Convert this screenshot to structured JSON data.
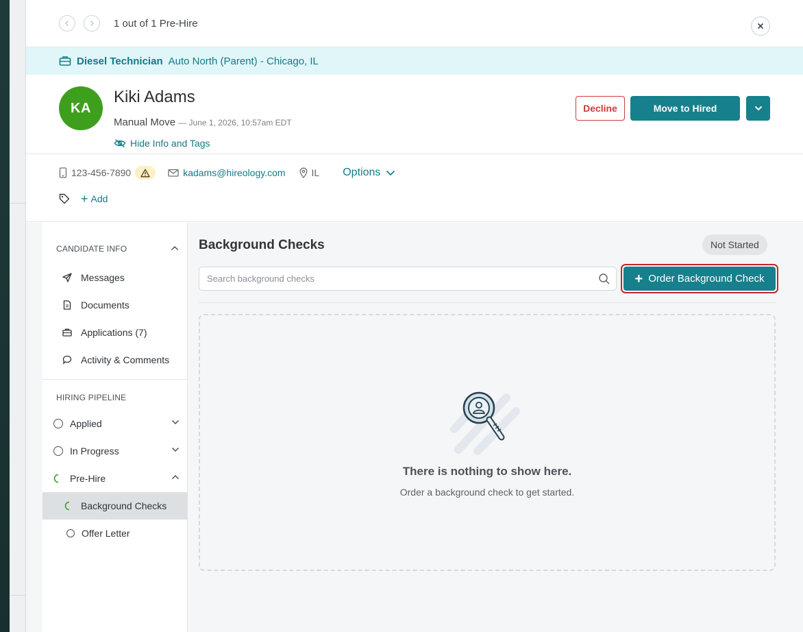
{
  "pager": {
    "text": "1 out of 1 Pre-Hire"
  },
  "job": {
    "title": "Diesel Technician",
    "location": "Auto North (Parent) - Chicago, IL"
  },
  "candidate": {
    "initials": "KA",
    "name": "Kiki Adams",
    "move_type": "Manual Move",
    "move_date": "— June 1, 2026, 10:57am EDT",
    "hide_info_label": "Hide Info and Tags",
    "avatar_color": "#3e9f1d"
  },
  "actions": {
    "decline_label": "Decline",
    "hire_label": "Move to Hired"
  },
  "contact": {
    "phone": "123-456-7890",
    "email": "kadams@hireology.com",
    "state": "IL",
    "options_label": "Options"
  },
  "tags": {
    "add_label": "Add"
  },
  "sidebar": {
    "candidate_info_header": "CANDIDATE INFO",
    "items": [
      {
        "label": "Messages",
        "icon": "send-icon"
      },
      {
        "label": "Documents",
        "icon": "document-icon"
      },
      {
        "label": "Applications (7)",
        "icon": "briefcase-icon"
      },
      {
        "label": "Activity & Comments",
        "icon": "comment-icon"
      }
    ],
    "pipeline_header": "HIRING PIPELINE",
    "pipeline": [
      {
        "label": "Applied",
        "state": "open"
      },
      {
        "label": "In Progress",
        "state": "open"
      },
      {
        "label": "Pre-Hire",
        "state": "in-progress"
      },
      {
        "label": "Background Checks",
        "state": "in-progress"
      },
      {
        "label": "Offer Letter",
        "state": "open"
      }
    ]
  },
  "main": {
    "title": "Background Checks",
    "status": "Not Started",
    "search_placeholder": "Search background checks",
    "order_label": "Order Background Check",
    "empty_title": "There is nothing to show here.",
    "empty_subtitle": "Order a background check to get started."
  },
  "colors": {
    "accent": "#16808c",
    "danger": "#cf3a3a",
    "banner": "#e0f6f9"
  }
}
